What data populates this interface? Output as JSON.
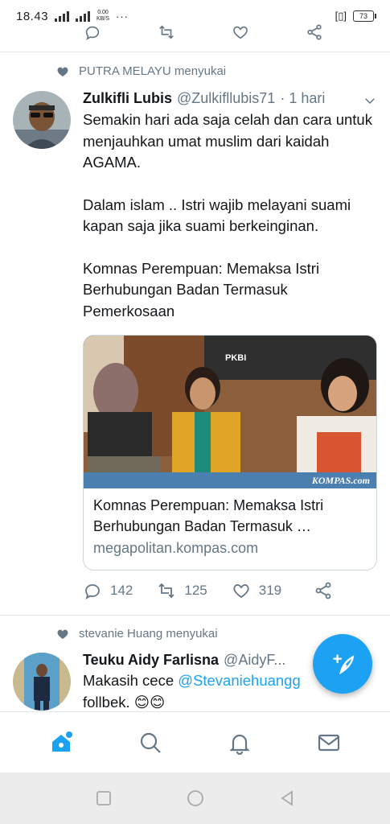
{
  "status_bar": {
    "time": "18.43",
    "net_speed_value": "0.00",
    "net_speed_unit": "KB/S",
    "dots": "···",
    "battery": "73"
  },
  "tweet1": {
    "social_context": "PUTRA MELAYU menyukai",
    "name": "Zulkifli Lubis",
    "handle": "@Zulkifllubis71",
    "time": "· 1 hari",
    "text_p1": "Semakin hari ada saja celah dan cara untuk menjauhkan umat muslim dari kaidah AGAMA.",
    "text_p2": "Dalam islam .. Istri wajib melayani suami kapan saja jika suami berkeinginan.",
    "text_p3": "Komnas Perempuan: Memaksa Istri Berhubungan Badan Termasuk Pemerkosaan",
    "card": {
      "image_banner": "PKBI",
      "image_watermark": "KOMPAS.com",
      "title": "Komnas Perempuan: Memaksa Istri Berhubungan Badan Termasuk …",
      "domain": "megapolitan.kompas.com"
    },
    "replies": "142",
    "retweets": "125",
    "likes": "319"
  },
  "tweet2": {
    "social_context": "stevanie Huang menyukai",
    "name": "Teuku Aidy Farlisna",
    "handle": "@AidyF...",
    "text_before": "Makasih cece ",
    "mention": "@Stevaniehuangg",
    "text_after": "follbek. ",
    "emoji": "😊😊"
  },
  "colors": {
    "accent": "#1da1f2",
    "text": "#14171a",
    "secondary": "#657786",
    "divider": "#e1e8ed"
  },
  "icons": [
    "reply-icon",
    "retweet-icon",
    "heart-icon",
    "share-icon",
    "chevron-down-icon",
    "compose-icon",
    "home-icon",
    "search-icon",
    "bell-icon",
    "mail-icon"
  ]
}
